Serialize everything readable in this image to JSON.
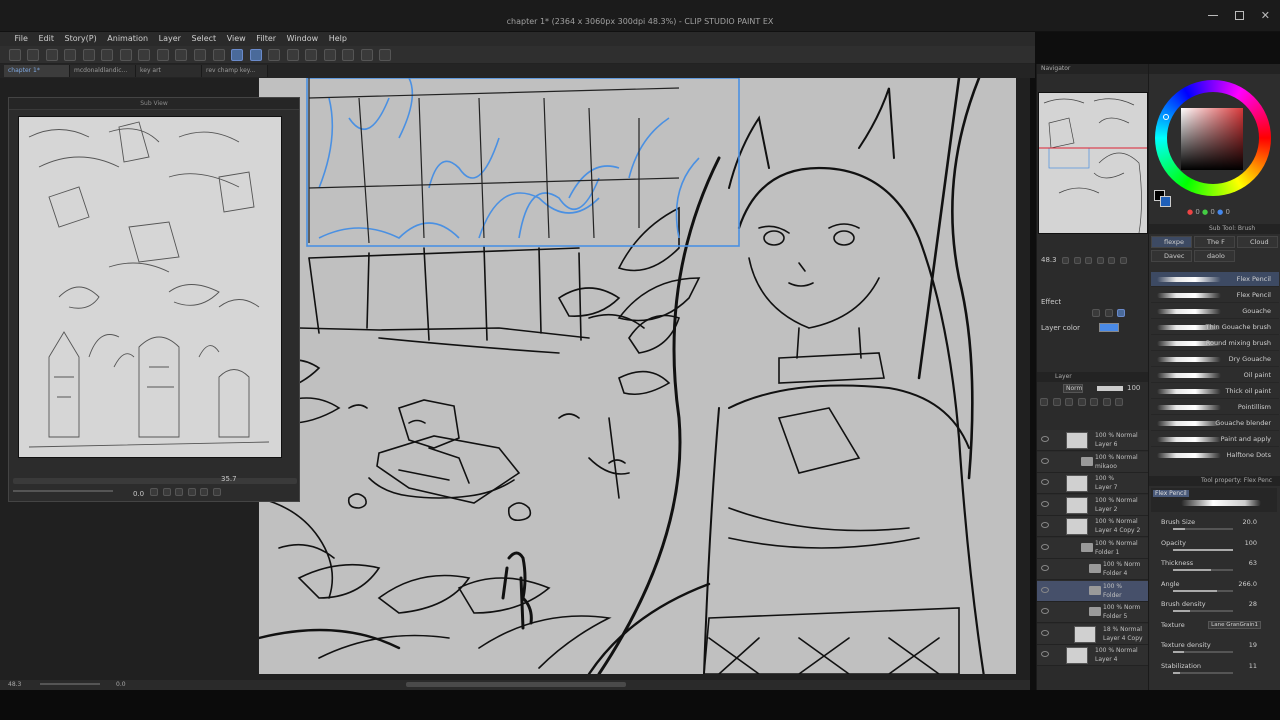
{
  "window": {
    "title": "chapter 1* (2364 x 3060px 300dpi 48.3%) - CLIP STUDIO PAINT EX"
  },
  "menu": [
    "File",
    "Edit",
    "Story(P)",
    "Animation",
    "Layer",
    "Select",
    "View",
    "Filter",
    "Window",
    "Help"
  ],
  "tabs": [
    {
      "label": "chapter 1*",
      "active": true
    },
    {
      "label": "mcdonaldlandic...",
      "active": false
    },
    {
      "label": "key art",
      "active": false
    },
    {
      "label": "rev champ key...",
      "active": false
    }
  ],
  "subview": {
    "title": "Sub View",
    "zoom": "35.7",
    "angle": "0.0"
  },
  "status": {
    "zoom": "48.3",
    "angle": "0.0"
  },
  "navigator": {
    "title": "Navigator",
    "zoom": "48.3"
  },
  "color": {
    "fg": "#000000",
    "bg": "#1f5fb8",
    "hue_accent": "#d8383a",
    "values": [
      "0",
      "0",
      "0"
    ]
  },
  "subtool": {
    "title": "Sub Tool: Brush",
    "tabs": [
      "flexpe",
      "The F",
      "Cloud",
      "Davec",
      "daolo"
    ],
    "brushes": [
      {
        "name": "Flex Pencil",
        "selected": true
      },
      {
        "name": "Flex Pencil",
        "selected": false
      },
      {
        "name": "Gouache",
        "selected": false
      },
      {
        "name": "Thin Gouache brush",
        "selected": false
      },
      {
        "name": "Round mixing brush",
        "selected": false
      },
      {
        "name": "Dry Gouache",
        "selected": false
      },
      {
        "name": "Oil paint",
        "selected": false
      },
      {
        "name": "Thick oil paint",
        "selected": false
      },
      {
        "name": "Pointillism",
        "selected": false
      },
      {
        "name": "Gouache blender",
        "selected": false
      },
      {
        "name": "Paint and apply",
        "selected": false
      },
      {
        "name": "Halftone Dots",
        "selected": false
      }
    ]
  },
  "toolprop": {
    "title": "Tool property: Flex Penc",
    "preview_label": "Flex Pencil",
    "props": [
      {
        "label": "Brush Size",
        "value": "20.0",
        "fill": 0.2
      },
      {
        "label": "Opacity",
        "value": "100",
        "fill": 1.0
      },
      {
        "label": "Thickness",
        "value": "63",
        "fill": 0.63
      },
      {
        "label": "Angle",
        "value": "266.0",
        "fill": 0.74
      },
      {
        "label": "Brush density",
        "value": "28",
        "fill": 0.28
      },
      {
        "label": "Texture",
        "value": "Lane GranGrain1",
        "fill": null
      },
      {
        "label": "Texture density",
        "value": "19",
        "fill": 0.19
      },
      {
        "label": "Stabilization",
        "value": "11",
        "fill": 0.11
      }
    ]
  },
  "layerpanel": {
    "title": "Layer",
    "effect_label": "Effect",
    "layer_color_label": "Layer color",
    "blend": "Norm",
    "opacity": "100",
    "layers": [
      {
        "top": "100 % Normal",
        "name": "Layer 6",
        "kind": "layer",
        "indent": 0,
        "selected": false
      },
      {
        "top": "100 % Normal",
        "name": "mikaoo",
        "kind": "folder",
        "indent": 0,
        "selected": false
      },
      {
        "top": "100 %",
        "name": "Layer 7",
        "kind": "layer",
        "indent": 0,
        "selected": false
      },
      {
        "top": "100 % Normal",
        "name": "Layer 2",
        "kind": "layer",
        "indent": 0,
        "selected": false
      },
      {
        "top": "100 % Normal",
        "name": "Layer 4 Copy 2",
        "kind": "layer",
        "indent": 0,
        "selected": false
      },
      {
        "top": "100 % Normal",
        "name": "Folder 1",
        "kind": "folder",
        "indent": 0,
        "selected": false
      },
      {
        "top": "100 % Norm",
        "name": "Folder 4",
        "kind": "folder",
        "indent": 1,
        "selected": false
      },
      {
        "top": "100 %",
        "name": "Folder",
        "kind": "folder",
        "indent": 1,
        "selected": true
      },
      {
        "top": "100 % Norm",
        "name": "Folder 5",
        "kind": "folder",
        "indent": 1,
        "selected": false
      },
      {
        "top": "18 % Normal",
        "name": "Layer 4 Copy",
        "kind": "layer",
        "indent": 1,
        "selected": false
      },
      {
        "top": "100 % Normal",
        "name": "Layer 4",
        "kind": "layer",
        "indent": 0,
        "selected": false
      }
    ]
  }
}
